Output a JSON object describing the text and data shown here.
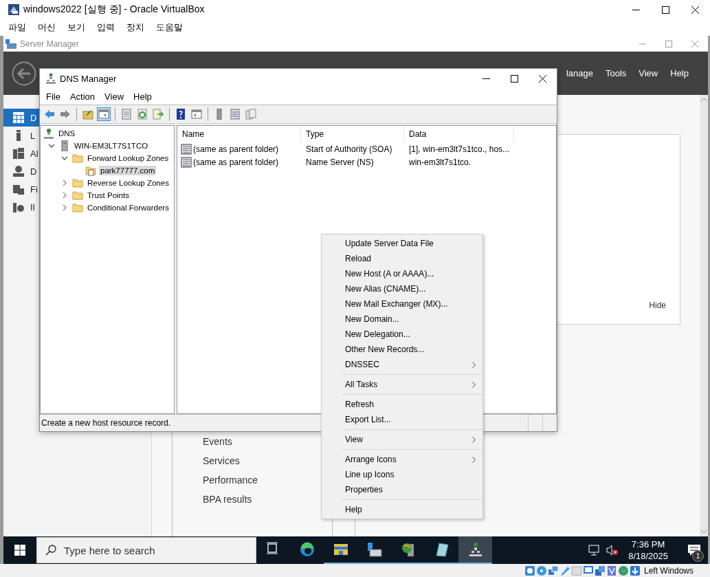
{
  "window": {
    "title": "windows2022 [실행 중] - Oracle VirtualBox"
  },
  "menu": [
    "파일",
    "머신",
    "보기",
    "입력",
    "장치",
    "도움말"
  ],
  "server_manager": {
    "title": "Server Manager",
    "header_menu": [
      "lanage",
      "Tools",
      "View",
      "Help"
    ],
    "nav": [
      {
        "kind": "dashboard",
        "label": "D",
        "selected": true
      },
      {
        "kind": "local",
        "label": "L",
        "selected": false
      },
      {
        "kind": "all",
        "label": "Al",
        "selected": false
      },
      {
        "kind": "dns",
        "label": "D",
        "selected": false
      },
      {
        "kind": "files",
        "label": "Fi",
        "selected": false
      },
      {
        "kind": "iis",
        "label": "II",
        "selected": false
      }
    ],
    "panel_button": "Hide",
    "tile_links": [
      "Events",
      "Services",
      "Performance",
      "BPA results"
    ]
  },
  "dns_manager": {
    "title": "DNS Manager",
    "menu": [
      "File",
      "Action",
      "View",
      "Help"
    ],
    "toolbar": [
      {
        "kind": "back",
        "pressed": false
      },
      {
        "kind": "forward",
        "pressed": false
      },
      {
        "kind": "sep"
      },
      {
        "kind": "up",
        "pressed": false
      },
      {
        "kind": "tree",
        "pressed": true
      },
      {
        "kind": "sep"
      },
      {
        "kind": "props",
        "pressed": false
      },
      {
        "kind": "refresh",
        "pressed": false
      },
      {
        "kind": "export",
        "pressed": false
      },
      {
        "kind": "sep"
      },
      {
        "kind": "help",
        "pressed": false
      },
      {
        "kind": "action",
        "pressed": false
      },
      {
        "kind": "sep"
      },
      {
        "kind": "server",
        "pressed": false
      },
      {
        "kind": "list",
        "pressed": false
      },
      {
        "kind": "records",
        "pressed": false
      }
    ],
    "tree": [
      {
        "kind": "root",
        "label": "DNS",
        "selected": false,
        "children": [
          {
            "kind": "server",
            "label": "WIN-EM3LT7S1TCO",
            "expanded": true,
            "selected": false,
            "children": [
              {
                "kind": "folder",
                "label": "Forward Lookup Zones",
                "expanded": true,
                "selected": false,
                "children": [
                  {
                    "kind": "zone",
                    "label": "park77777.com",
                    "selected": true
                  }
                ]
              },
              {
                "kind": "folder",
                "label": "Reverse Lookup Zones",
                "expanded": false,
                "selected": false
              },
              {
                "kind": "folder",
                "label": "Trust Points",
                "expanded": false,
                "selected": false
              },
              {
                "kind": "folder",
                "label": "Conditional Forwarders",
                "expanded": false,
                "selected": false
              }
            ]
          }
        ]
      }
    ],
    "columns": [
      "Name",
      "Type",
      "Data"
    ],
    "rows": [
      {
        "name": "(same as parent folder)",
        "type": "Start of Authority (SOA)",
        "data": "[1], win-em3lt7s1tco., hos..."
      },
      {
        "name": "(same as parent folder)",
        "type": "Name Server (NS)",
        "data": "win-em3lt7s1tco."
      }
    ],
    "status": "Create a new host resource record."
  },
  "context_menu": [
    {
      "kind": "item",
      "label": "Update Server Data File",
      "submenu": false
    },
    {
      "kind": "item",
      "label": "Reload",
      "submenu": false
    },
    {
      "kind": "item",
      "label": "New Host (A or AAAA)...",
      "submenu": false
    },
    {
      "kind": "item",
      "label": "New Alias (CNAME)...",
      "submenu": false
    },
    {
      "kind": "item",
      "label": "New Mail Exchanger (MX)...",
      "submenu": false
    },
    {
      "kind": "item",
      "label": "New Domain...",
      "submenu": false
    },
    {
      "kind": "item",
      "label": "New Delegation...",
      "submenu": false
    },
    {
      "kind": "item",
      "label": "Other New Records...",
      "submenu": false
    },
    {
      "kind": "item",
      "label": "DNSSEC",
      "submenu": true
    },
    {
      "kind": "separator"
    },
    {
      "kind": "item",
      "label": "All Tasks",
      "submenu": true
    },
    {
      "kind": "separator"
    },
    {
      "kind": "item",
      "label": "Refresh",
      "submenu": false
    },
    {
      "kind": "item",
      "label": "Export List...",
      "submenu": false
    },
    {
      "kind": "separator"
    },
    {
      "kind": "item",
      "label": "View",
      "submenu": true
    },
    {
      "kind": "separator"
    },
    {
      "kind": "item",
      "label": "Arrange Icons",
      "submenu": true
    },
    {
      "kind": "item",
      "label": "Line up Icons",
      "submenu": false
    },
    {
      "kind": "item",
      "label": "Properties",
      "submenu": false
    },
    {
      "kind": "separator"
    },
    {
      "kind": "item",
      "label": "Help",
      "submenu": false
    }
  ],
  "taskbar": {
    "search_placeholder": "Type here to search",
    "apps": [
      {
        "kind": "taskview",
        "running": false,
        "active": false
      },
      {
        "kind": "edge",
        "running": false,
        "active": false
      },
      {
        "kind": "explorer",
        "running": true,
        "active": false
      },
      {
        "kind": "servermanager",
        "running": true,
        "active": false
      },
      {
        "kind": "globe",
        "running": true,
        "active": false
      },
      {
        "kind": "notepad",
        "running": true,
        "active": false
      },
      {
        "kind": "dns",
        "running": true,
        "active": true
      }
    ],
    "time": "7:36 PM",
    "date": "8/18/2025",
    "notification_count": "1"
  },
  "status_bar": {
    "host_key": "Left Windows"
  }
}
